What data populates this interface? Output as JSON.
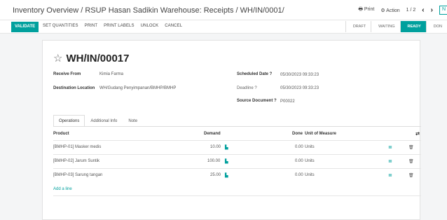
{
  "breadcrumb": {
    "part1": "Inventory Overview",
    "sep": " / ",
    "part2": "RSUP Hasan Sadikin Warehouse: Receipts",
    "part3": "WH/IN/0001/"
  },
  "topbar": {
    "print_label": "Print",
    "action_label": "Action",
    "pager": "1 / 2",
    "new_label": "N"
  },
  "actions": {
    "validate": "VALIDATE",
    "buttons": [
      "SET QUANTITIES",
      "PRINT",
      "PRINT LABELS",
      "UNLOCK",
      "CANCEL"
    ]
  },
  "status": {
    "steps": [
      "DRAFT",
      "WAITING",
      "READY",
      "DON"
    ],
    "active": "READY"
  },
  "record": {
    "title": "WH/IN/00017",
    "receive_from_label": "Receive From",
    "receive_from": "Kimia Farma",
    "destination_label": "Destination Location",
    "destination": "WH/Gudang Penyimpanan/BMHP/BMHP",
    "scheduled_label": "Scheduled Date ?",
    "scheduled": "05/30/2023 09:33:23",
    "deadline_label": "Deadline ?",
    "deadline": "05/30/2023 09:33:23",
    "source_label": "Source Document ?",
    "source": "P00022"
  },
  "tabs": [
    "Operations",
    "Additional Info",
    "Note"
  ],
  "table": {
    "headers": {
      "product": "Product",
      "demand": "Demand",
      "done": "Done",
      "uom": "Unit of Measure"
    },
    "rows": [
      {
        "product": "[BMHP-01] Masker medis",
        "demand": "10.00",
        "done": "0.00",
        "uom": "Units"
      },
      {
        "product": "[BMHP-02] Jarum Suntik",
        "demand": "100.00",
        "done": "0.00",
        "uom": "Units"
      },
      {
        "product": "[BMHP-03] Sarung tangan",
        "demand": "25.00",
        "done": "0.00",
        "uom": "Units"
      }
    ],
    "add_line": "Add a line"
  },
  "icons": {
    "star": "star-icon",
    "print": "print-icon",
    "gear": "gear-icon",
    "chart": "chart-icon",
    "list": "list-icon",
    "trash": "trash-icon"
  },
  "colors": {
    "accent": "#00a09d"
  }
}
